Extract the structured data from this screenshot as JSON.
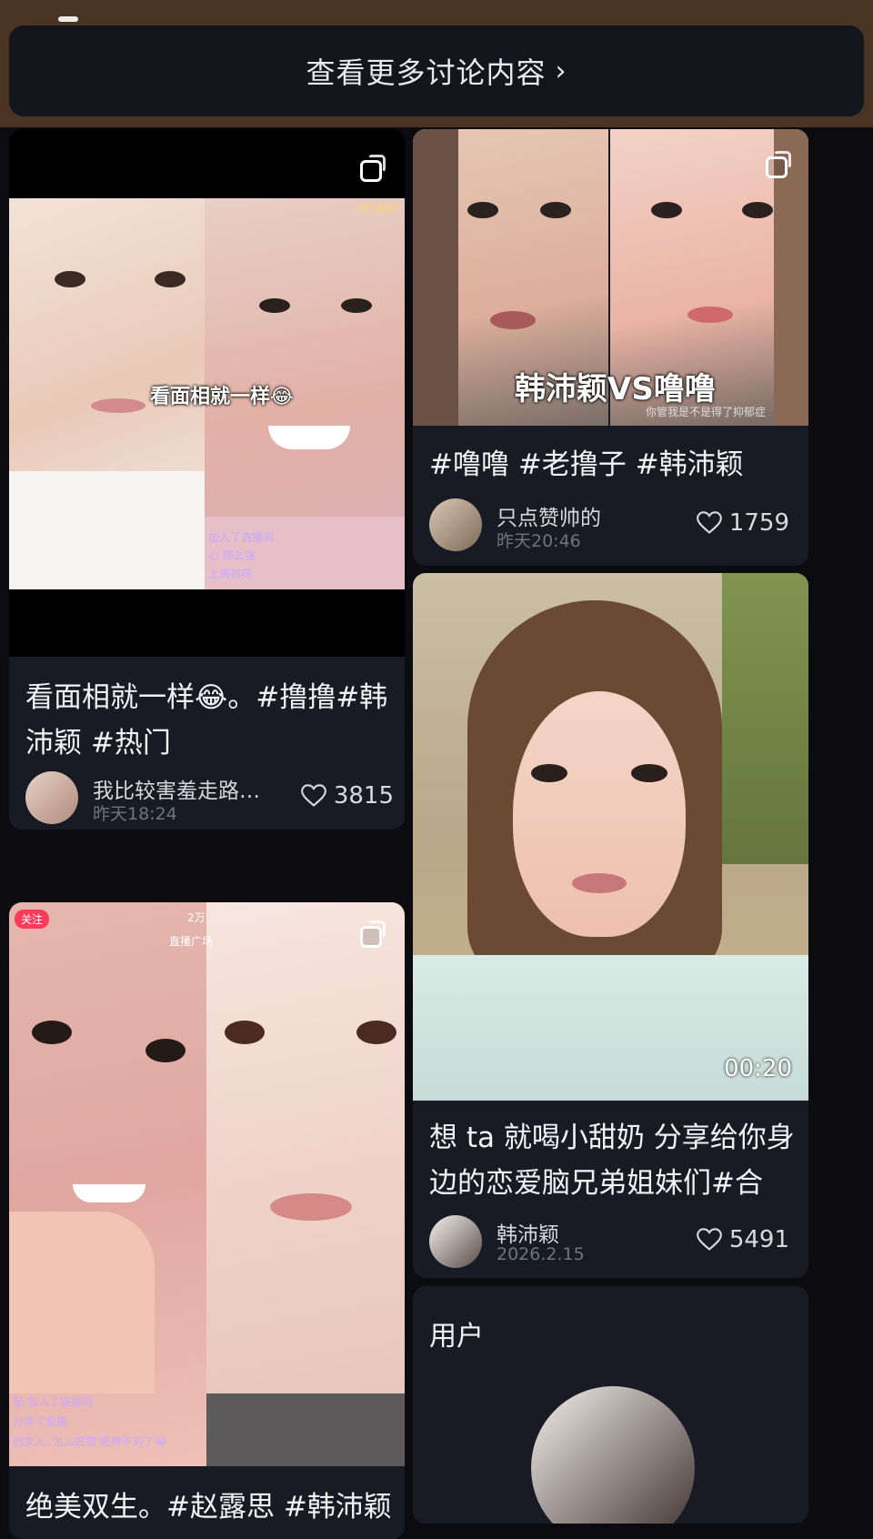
{
  "header": {
    "more_label": "查看更多讨论内容",
    "chevron": "chevron-right-icon"
  },
  "cards": [
    {
      "overlay_caption": "看面相就一样😂",
      "title_line1": "看面相就一样😂。#撸撸#韩",
      "title_line2": "沛颖 #热门",
      "author": "我比较害羞走路…",
      "time": "昨天18:24",
      "likes": "3815",
      "live_counter": "0/1400",
      "chat": [
        "加入了直播间",
        "心 那么强",
        "上闹祸呀"
      ]
    },
    {
      "overlay_caption": "韩沛颖VS噜噜",
      "overlay_sub": "你管我是不是得了抑郁症",
      "title": "#噜噜 #老撸子 #韩沛颖",
      "author": "只点赞帅的",
      "time": "昨天20:46",
      "likes": "1759"
    },
    {
      "follow_badge": "关注",
      "live_count": "2万",
      "live_square": "直播广场",
      "title": "绝美双生。#赵露思 #韩沛颖",
      "chat": [
        "茄 加入了直播间",
        "分享了直播",
        "的女人: 怎么感觉 眼神不对了😂"
      ]
    },
    {
      "duration": "00:20",
      "title_line1": "想 ta 就喝小甜奶 分享给你身",
      "title_line2": "边的恋爱脑兄弟姐妹们#合",
      "author": "韩沛颖",
      "time": "2026.2.15",
      "likes": "5491"
    }
  ],
  "users_section": {
    "title": "用户"
  },
  "colors": {
    "background": "#0b0b10",
    "card": "#181b24",
    "top_band": "#4a3322",
    "badge": "#ff3b5c"
  }
}
